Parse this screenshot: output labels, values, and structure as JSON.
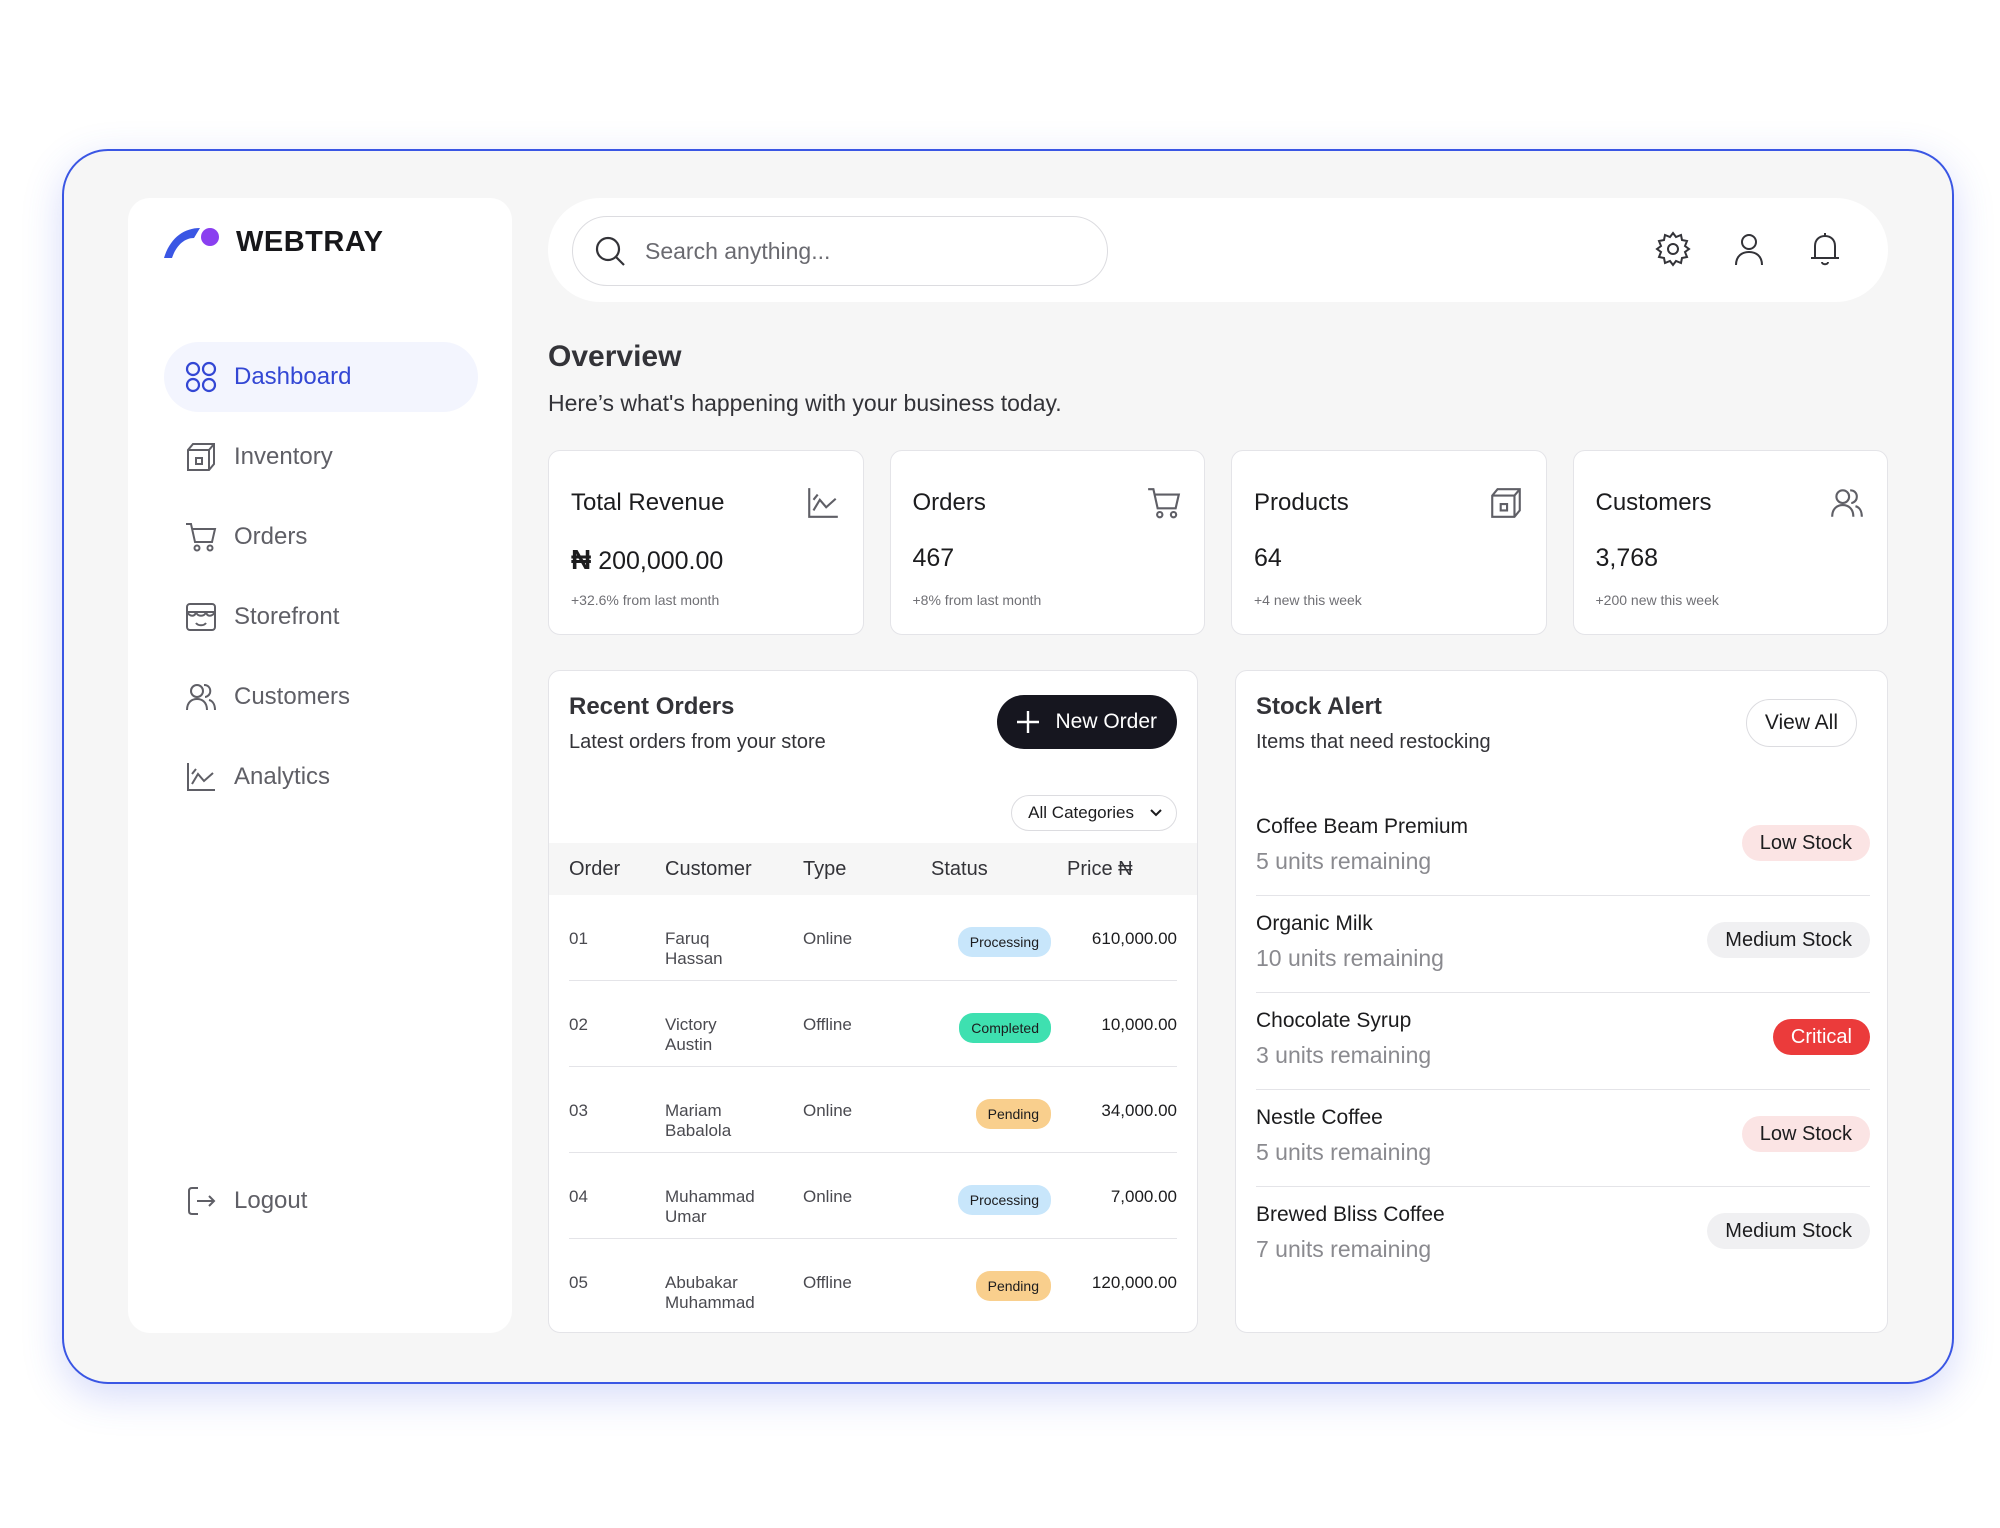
{
  "brand": {
    "name": "WEBTRAY",
    "colors": {
      "accent": "#3347d4",
      "logo_blue": "#3a56e4",
      "logo_purple": "#8a3ff0"
    }
  },
  "sidebar": {
    "items": [
      {
        "label": "Dashboard",
        "icon": "dashboard-grid-icon"
      },
      {
        "label": "Inventory",
        "icon": "box-icon"
      },
      {
        "label": "Orders",
        "icon": "cart-icon"
      },
      {
        "label": "Storefront",
        "icon": "storefront-icon"
      },
      {
        "label": "Customers",
        "icon": "users-icon"
      },
      {
        "label": "Analytics",
        "icon": "chart-icon"
      }
    ],
    "active": "Dashboard",
    "logout_label": "Logout"
  },
  "topbar": {
    "search_placeholder": "Search anything...",
    "icons": [
      "gear-icon",
      "user-icon",
      "bell-icon"
    ]
  },
  "overview": {
    "title": "Overview",
    "subtitle": "Here’s what's happening with your business today."
  },
  "stats": [
    {
      "label": "Total Revenue",
      "currency": "₦",
      "value": "200,000.00",
      "note": "+32.6% from last month",
      "icon": "chart-icon"
    },
    {
      "label": "Orders",
      "value": "467",
      "note": "+8% from last month",
      "icon": "cart-icon"
    },
    {
      "label": "Products",
      "value": "64",
      "note": "+4 new this week",
      "icon": "box-icon"
    },
    {
      "label": "Customers",
      "value": "3,768",
      "note": "+200 new this week",
      "icon": "users-icon"
    }
  ],
  "recent_orders": {
    "title": "Recent Orders",
    "subtitle": "Latest orders from your store",
    "new_order_label": "New Order",
    "filter_label": "All Categories",
    "columns": {
      "order": "Order",
      "customer": "Customer",
      "type": "Type",
      "status": "Status",
      "price": "Price ₦"
    },
    "rows": [
      {
        "order": "01",
        "customer_first": "Faruq",
        "customer_last": "Hassan",
        "type": "Online",
        "status": "Processing",
        "price": "610,000.00"
      },
      {
        "order": "02",
        "customer_first": "Victory",
        "customer_last": "Austin",
        "type": "Offline",
        "status": "Completed",
        "price": "10,000.00"
      },
      {
        "order": "03",
        "customer_first": "Mariam",
        "customer_last": "Babalola",
        "type": "Online",
        "status": "Pending",
        "price": "34,000.00"
      },
      {
        "order": "04",
        "customer_first": "Muhammad",
        "customer_last": "Umar",
        "type": "Online",
        "status": "Processing",
        "price": "7,000.00"
      },
      {
        "order": "05",
        "customer_first": "Abubakar",
        "customer_last": "Muhammad",
        "type": "Offline",
        "status": "Pending",
        "price": "120,000.00"
      }
    ],
    "status_colors": {
      "Processing": "#c8e6fb",
      "Completed": "#3ee0b0",
      "Pending": "#f9cf8d"
    }
  },
  "stock_alert": {
    "title": "Stock Alert",
    "subtitle": "Items that need restocking",
    "view_all_label": "View All",
    "items": [
      {
        "name": "Coffee Beam Premium",
        "units": "5 units remaining",
        "level": "Low Stock"
      },
      {
        "name": "Organic Milk",
        "units": "10 units remaining",
        "level": "Medium Stock"
      },
      {
        "name": "Chocolate Syrup",
        "units": "3 units remaining",
        "level": "Critical"
      },
      {
        "name": "Nestle Coffee",
        "units": "5 units remaining",
        "level": "Low Stock"
      },
      {
        "name": "Brewed Bliss Coffee",
        "units": "7 units remaining",
        "level": "Medium Stock"
      }
    ],
    "level_colors": {
      "Low Stock": "#fbe4e4",
      "Medium Stock": "#f0f0f2",
      "Critical": "#eb3b3b"
    }
  }
}
